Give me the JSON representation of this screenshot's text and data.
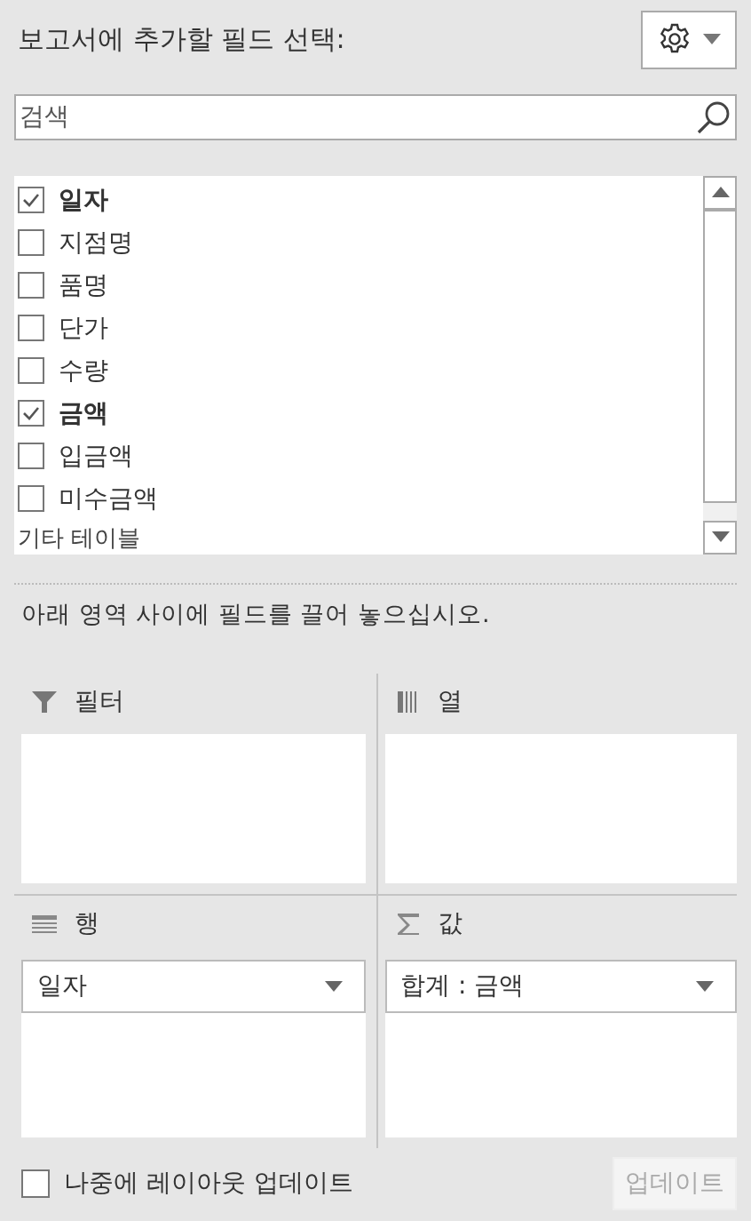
{
  "header": {
    "title": "보고서에 추가할 필드 선택:"
  },
  "search": {
    "placeholder": "검색"
  },
  "fields": [
    {
      "label": "일자",
      "checked": true
    },
    {
      "label": "지점명",
      "checked": false
    },
    {
      "label": "품명",
      "checked": false
    },
    {
      "label": "단가",
      "checked": false
    },
    {
      "label": "수량",
      "checked": false
    },
    {
      "label": "금액",
      "checked": true
    },
    {
      "label": "입금액",
      "checked": false
    },
    {
      "label": "미수금액",
      "checked": false
    }
  ],
  "more_tables": "기타 테이블",
  "instruction": "아래 영역 사이에 필드를 끌어 놓으십시오.",
  "areas": [
    {
      "kind": "filter",
      "label": "필터"
    },
    {
      "kind": "columns",
      "label": "열"
    },
    {
      "kind": "rows",
      "label": "행",
      "items": [
        "일자"
      ]
    },
    {
      "kind": "values",
      "label": "값",
      "items": [
        "합계 : 금액"
      ]
    }
  ],
  "footer": {
    "defer_label": "나중에 레이아웃 업데이트",
    "defer_checked": false,
    "update_button": "업데이트",
    "update_disabled": true
  }
}
